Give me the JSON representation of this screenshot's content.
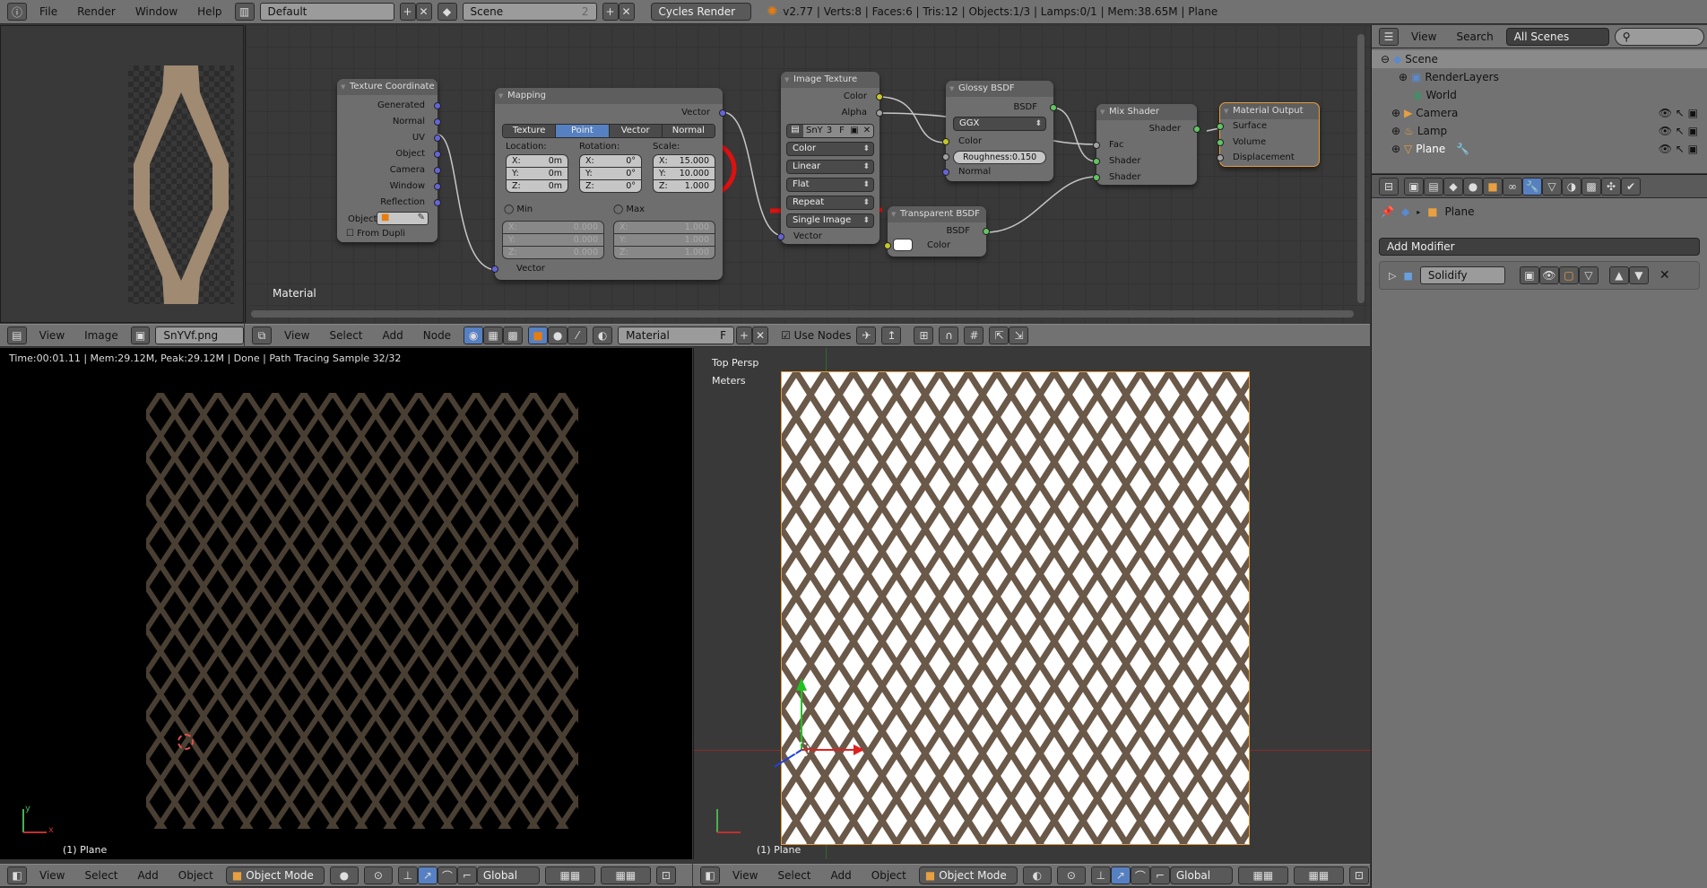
{
  "topbar": {
    "menus": [
      "File",
      "Render",
      "Window",
      "Help"
    ],
    "layout": "Default",
    "scene": "Scene",
    "scene_users": "2",
    "engine": "Cycles Render",
    "stats": "v2.77 | Verts:8 | Faces:6 | Tris:12 | Objects:1/3 | Lamps:0/1 | Mem:38.65M | Plane"
  },
  "node_editor": {
    "label": "Material",
    "header": {
      "menus": [
        "View",
        "Select",
        "Add",
        "Node"
      ],
      "material": "Material",
      "fake_user": "F",
      "use_nodes_label": "Use Nodes",
      "use_nodes": true
    },
    "texture_coordinate": {
      "title": "Texture Coordinate",
      "outputs": [
        "Generated",
        "Normal",
        "UV",
        "Object",
        "Camera",
        "Window",
        "Reflection"
      ],
      "object_label": "Object",
      "from_dupli": "From Dupli"
    },
    "mapping": {
      "title": "Mapping",
      "output": "Vector",
      "input": "Vector",
      "tabs": [
        "Texture",
        "Point",
        "Vector",
        "Normal"
      ],
      "active_tab": "Point",
      "location_label": "Location:",
      "rotation_label": "Rotation:",
      "scale_label": "Scale:",
      "location": [
        [
          "X:",
          "0m"
        ],
        [
          "Y:",
          "0m"
        ],
        [
          "Z:",
          "0m"
        ]
      ],
      "rotation": [
        [
          "X:",
          "0°"
        ],
        [
          "Y:",
          "0°"
        ],
        [
          "Z:",
          "0°"
        ]
      ],
      "scale": [
        [
          "X:",
          "15.000"
        ],
        [
          "Y:",
          "10.000"
        ],
        [
          "Z:",
          "1.000"
        ]
      ],
      "min_label": "Min",
      "max_label": "Max",
      "min": [
        [
          "X:",
          "0.000"
        ],
        [
          "Y:",
          "0.000"
        ],
        [
          "Z:",
          "0.000"
        ]
      ],
      "max": [
        [
          "X:",
          "1.000"
        ],
        [
          "Y:",
          "1.000"
        ],
        [
          "Z:",
          "1.000"
        ]
      ]
    },
    "image_texture": {
      "title": "Image Texture",
      "outputs": [
        "Color",
        "Alpha"
      ],
      "image_name": "SnY",
      "users": "3",
      "fake": "F",
      "color_space": "Color",
      "interpolation": "Linear",
      "projection": "Flat",
      "extension": "Repeat",
      "source": "Single Image",
      "input": "Vector"
    },
    "glossy": {
      "title": "Glossy BSDF",
      "output": "BSDF",
      "distribution": "GGX",
      "color": "Color",
      "roughness_label": "Roughness:",
      "roughness": "0.150",
      "normal": "Normal"
    },
    "transparent": {
      "title": "Transparent BSDF",
      "output": "BSDF",
      "color": "Color"
    },
    "mix": {
      "title": "Mix Shader",
      "output": "Shader",
      "inputs": [
        "Fac",
        "Shader",
        "Shader"
      ]
    },
    "output": {
      "title": "Material Output",
      "inputs": [
        "Surface",
        "Volume",
        "Displacement"
      ]
    }
  },
  "image_editor": {
    "header": {
      "menus": [
        "View",
        "Image"
      ],
      "image": "SnYVf.png"
    }
  },
  "render_view": {
    "status": "Time:00:01.11 | Mem:29.12M, Peak:29.12M | Done | Path Tracing Sample 32/32",
    "object_label": "(1) Plane",
    "axis_x": "x",
    "axis_y": "y"
  },
  "viewport": {
    "view_name": "Top Persp",
    "units": "Meters",
    "object_label": "(1) Plane"
  },
  "view3d_header": {
    "menus": [
      "View",
      "Select",
      "Add",
      "Object"
    ],
    "mode": "Object Mode",
    "orientation": "Global"
  },
  "outliner": {
    "menus": [
      "View",
      "Search"
    ],
    "filter": "All Scenes",
    "items": [
      {
        "name": "Scene",
        "level": 0
      },
      {
        "name": "RenderLayers",
        "level": 1
      },
      {
        "name": "World",
        "level": 1
      },
      {
        "name": "Camera",
        "level": 1
      },
      {
        "name": "Lamp",
        "level": 1
      },
      {
        "name": "Plane",
        "level": 1
      }
    ]
  },
  "properties": {
    "breadcrumb": "Plane",
    "add_modifier": "Add Modifier",
    "modifier_name": "Solidify",
    "active_tab": "modifiers"
  },
  "annotation_color": "#e01010"
}
